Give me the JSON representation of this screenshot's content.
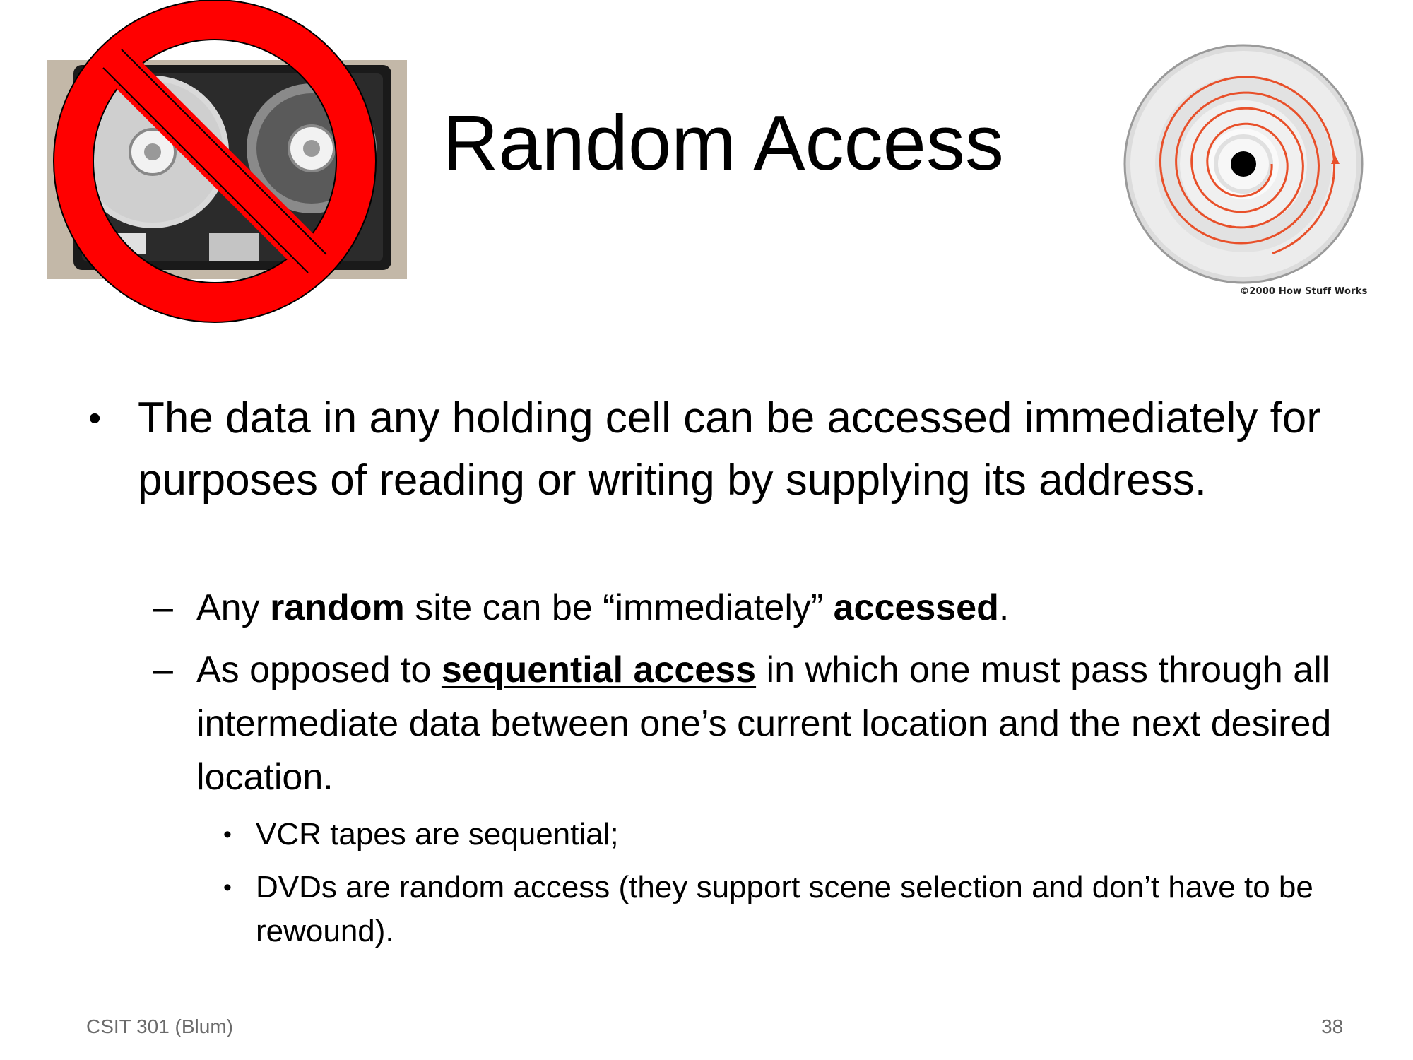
{
  "slide": {
    "title": "Random Access",
    "dvd_credit": "©2000 How Stuff Works",
    "bullet1": "The data in any holding cell can be accessed immediately for purposes of reading or writing by supplying its address.",
    "sub1": {
      "t1": "Any ",
      "b1": "random",
      "t2": " site can be “immediately” ",
      "b2": "accessed",
      "t3": "."
    },
    "sub2": {
      "t1": "As opposed to ",
      "u1": "sequential access",
      "t2": " in which one must pass through all intermediate data between one’s current location and the next desired location."
    },
    "sub3": "VCR tapes are sequential;",
    "sub4": "DVDs are random access (they support scene selection and don’t have to be rewound).",
    "footer_left": "CSIT 301 (Blum)",
    "footer_right": "38"
  },
  "colors": {
    "no_sign": "#ff0000",
    "dvd_spiral": "#e8502a",
    "footer_text": "#6b6b6b"
  },
  "icons": {
    "vcr_image": "vcr-tape-no-sign-icon",
    "dvd_image": "dvd-disc-spiral-icon"
  }
}
